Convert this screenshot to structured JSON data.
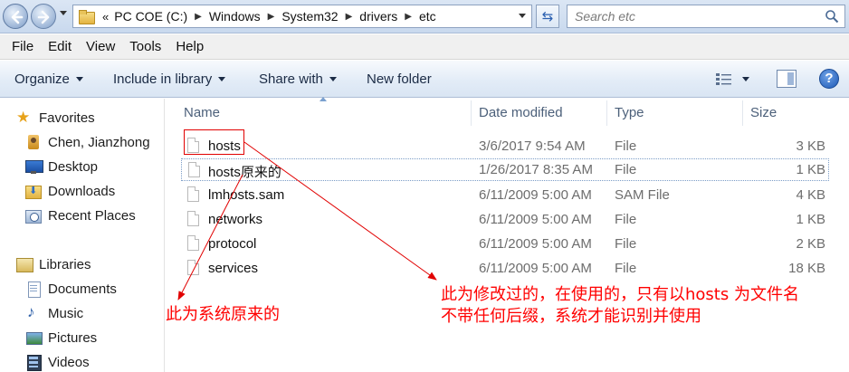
{
  "address": {
    "overflow": "«",
    "crumbs": [
      "PC COE (C:)",
      "Windows",
      "System32",
      "drivers",
      "etc"
    ]
  },
  "search": {
    "placeholder": "Search etc"
  },
  "menu": [
    "File",
    "Edit",
    "View",
    "Tools",
    "Help"
  ],
  "toolbar": {
    "organize": "Organize",
    "include": "Include in library",
    "share": "Share with",
    "new_folder": "New folder"
  },
  "nav": {
    "favorites": "Favorites",
    "favorites_items": [
      "Chen, Jianzhong",
      "Desktop",
      "Downloads",
      "Recent Places"
    ],
    "libraries": "Libraries",
    "libraries_items": [
      "Documents",
      "Music",
      "Pictures",
      "Videos"
    ]
  },
  "columns": {
    "name": "Name",
    "date": "Date modified",
    "type": "Type",
    "size": "Size"
  },
  "files": [
    {
      "name": "hosts",
      "date": "3/6/2017 9:54 AM",
      "type": "File",
      "size": "3 KB"
    },
    {
      "name": "hosts原来的",
      "date": "1/26/2017 8:35 AM",
      "type": "File",
      "size": "1 KB"
    },
    {
      "name": "lmhosts.sam",
      "date": "6/11/2009 5:00 AM",
      "type": "SAM File",
      "size": "4 KB"
    },
    {
      "name": "networks",
      "date": "6/11/2009 5:00 AM",
      "type": "File",
      "size": "1 KB"
    },
    {
      "name": "protocol",
      "date": "6/11/2009 5:00 AM",
      "type": "File",
      "size": "2 KB"
    },
    {
      "name": "services",
      "date": "6/11/2009 5:00 AM",
      "type": "File",
      "size": "18 KB"
    }
  ],
  "annotations": {
    "left": "此为系统原来的",
    "right_line1": "此为修改过的，在使用的，只有以hosts 为文件名",
    "right_line2": "不带任何后缀，系统才能识别并使用"
  },
  "colors": {
    "annotation": "#ff0000",
    "accent": "#1c58b5"
  }
}
